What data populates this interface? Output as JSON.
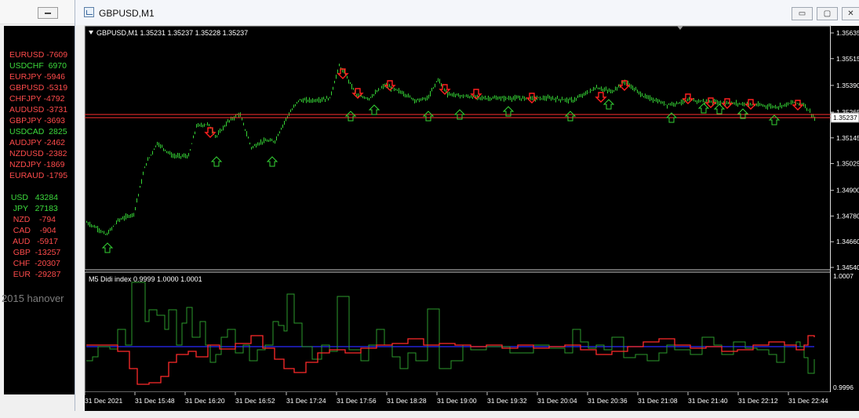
{
  "background_window": {
    "currency_pairs": [
      {
        "label": "EURUSD -7609",
        "color": "#ff4b4b"
      },
      {
        "label": "USDCHF  6970",
        "color": "#3ddb3d"
      },
      {
        "label": "EURJPY -5946",
        "color": "#ff4b4b"
      },
      {
        "label": "GBPUSD -5319",
        "color": "#ff4b4b"
      },
      {
        "label": "CHFJPY -4792",
        "color": "#ff4b4b"
      },
      {
        "label": "AUDUSD -3731",
        "color": "#ff4b4b"
      },
      {
        "label": "GBPJPY -3693",
        "color": "#ff4b4b"
      },
      {
        "label": "USDCAD  2825",
        "color": "#3ddb3d"
      },
      {
        "label": "AUDJPY -2462",
        "color": "#ff4b4b"
      },
      {
        "label": "NZDUSD -2382",
        "color": "#ff4b4b"
      },
      {
        "label": "NZDJPY -1869",
        "color": "#ff4b4b"
      },
      {
        "label": "EURAUD -1795",
        "color": "#ff4b4b"
      }
    ],
    "currencies": [
      {
        "label": "  USD   43284",
        "color": "#3ddb3d"
      },
      {
        "label": "   JPY   27183",
        "color": "#3ddb3d"
      },
      {
        "label": "   NZD    -794",
        "color": "#ff4b4b"
      },
      {
        "label": "   CAD    -904",
        "color": "#ff4b4b"
      },
      {
        "label": "   AUD   -5917",
        "color": "#ff4b4b"
      },
      {
        "label": "   GBP  -13257",
        "color": "#ff4b4b"
      },
      {
        "label": "   CHF  -20307",
        "color": "#ff4b4b"
      },
      {
        "label": "   EUR  -29287",
        "color": "#ff4b4b"
      }
    ],
    "watermark": "2015 hanover"
  },
  "window": {
    "title": "GBPUSD,M1",
    "buttons": {
      "minimize": "▭",
      "restore": "▢",
      "close": "✕"
    }
  },
  "main_chart": {
    "info": "GBPUSD,M1  1.35231 1.35237 1.35228 1.35237",
    "price_axis_labels": [
      "1.35635",
      "1.35515",
      "1.35390",
      "1.35265",
      "1.35145",
      "1.35025",
      "1.34900",
      "1.34780",
      "1.34660",
      "1.34540"
    ],
    "current_price_label": "1.35237",
    "colors": {
      "candles": "#35d435",
      "bid_line": "#ff3030",
      "ask_line": "#c0c0c0",
      "arrow_up": "#35d435",
      "arrow_down": "#ff2020"
    }
  },
  "sub_chart": {
    "info": "M5 Didi index 0.9999 1.0000 1.0001",
    "axis_labels": [
      "1.0007",
      "0.9996"
    ],
    "colors": {
      "green": "#2b9a2b",
      "red": "#ff2a2a",
      "blue": "#2b2bff"
    }
  },
  "time_axis_labels": [
    "31 Dec 2021",
    "31 Dec 15:48",
    "31 Dec 16:20",
    "31 Dec 16:52",
    "31 Dec 17:24",
    "31 Dec 17:56",
    "31 Dec 18:28",
    "31 Dec 19:00",
    "31 Dec 19:32",
    "31 Dec 20:04",
    "31 Dec 20:36",
    "31 Dec 21:08",
    "31 Dec 21:40",
    "31 Dec 22:12",
    "31 Dec 22:44"
  ]
}
